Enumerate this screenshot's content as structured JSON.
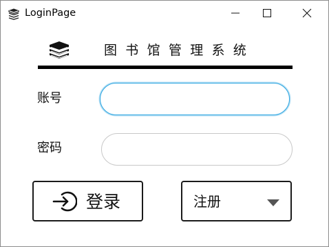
{
  "window": {
    "title": "LoginPage",
    "icon": "book-stack-icon",
    "controls": [
      "minimize-icon",
      "maximize-icon",
      "close-icon"
    ]
  },
  "header": {
    "logo_icon": "book-stack-icon",
    "app_title": "图书馆管理系统"
  },
  "form": {
    "account_label": "账号",
    "account_value": "",
    "password_label": "密码",
    "password_value": ""
  },
  "actions": {
    "login_label": "登录",
    "login_icon": "login-arrow-icon",
    "role_selected": "注册"
  },
  "colors": {
    "focus_border": "#2aa4e0",
    "border_dark": "#1a1a1a",
    "border_light": "#c8c8c8"
  }
}
